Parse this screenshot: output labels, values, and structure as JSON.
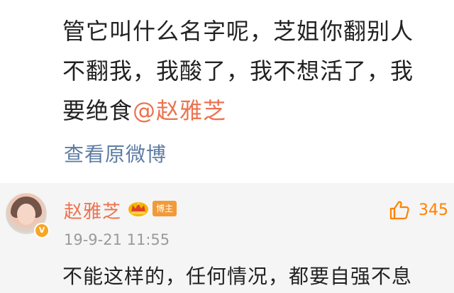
{
  "post": {
    "lines": [
      "管它叫什么名字呢，芝姐你翻别人",
      "不翻我，我酸了，我不想活了，我",
      "要绝食"
    ],
    "mention": "@赵雅芝",
    "view_original": "查看原微博"
  },
  "comment": {
    "username": "赵雅芝",
    "crown_icon": "crown-icon",
    "host_badge": "博主",
    "verified_badge": "V",
    "like_icon": "thumbs-up-icon",
    "like_count": "345",
    "timestamp": "19-9-21 11:55",
    "text": "不能这样的，任何情况，都要自强不息"
  },
  "colors": {
    "link": "#5d7ca3",
    "username": "#eb7350",
    "like": "#ff8200",
    "host_badge_bg": "#f29a38",
    "comment_bg": "#f5f5f5"
  }
}
